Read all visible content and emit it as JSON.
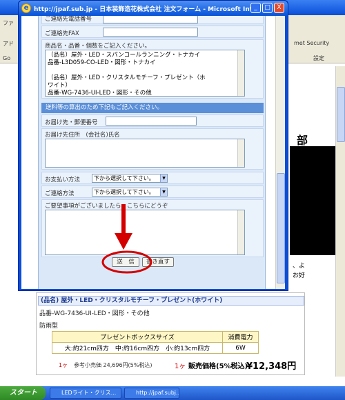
{
  "popup": {
    "title": "http://jpaf.sub.jp - 日本装飾造花株式会社 注文フォーム - Microsoft Interne...",
    "min_label": "_",
    "max_label": "□",
    "close_label": "X"
  },
  "form": {
    "phone_label": "ご連絡先電話番号",
    "fax_label": "ご連絡先FAX",
    "items_label": "商品名・品番・個数をご記入ください。",
    "items_text": "（品名）屋外・LED・スパンコールランニング・トナカイ\n品番-L3D059-CO-LED・図形・トナカイ\n\n（品名）屋外・LED・クリスタルモチーフ・プレゼント（ホ\nワイト）\n品番-WG-7436-UI-LED・図形・その他",
    "shipping_section": "送料等の算出のため下記もご記入ください。",
    "zip_label": "お届け先・郵便番号",
    "address_label": "お届け先住所　(会社名)氏名",
    "payment_label": "お支払い方法",
    "payment_value": "下から選択して下さい。",
    "contact_label": "ご連絡方法",
    "contact_value": "下から選択して下さい。",
    "requests_label": "ご要望事項がございましたら、こちらにどうぞ",
    "submit_label": "送　信",
    "reset_label": "書き直す"
  },
  "product": {
    "name": "(品名) 屋外・LED・クリスタルモチーフ・プレゼント(ホワイト)",
    "model": "品番-WG-7436-UI-LED・図形・その他",
    "weather": "防雨型",
    "table_headers": [
      "プレゼントボックスサイズ",
      "消費電力"
    ],
    "table_sizes": "大:約21cm四方　中:約16cm四方　小:約13cm四方",
    "table_power": "6W",
    "qty_small": "1ヶ",
    "reference_price": "参考小売価 24,696円(5%税込)",
    "qty_large": "1ヶ",
    "price_label": "販売価格(5%税込)",
    "price": "¥12,348円"
  },
  "background": {
    "heading": "部",
    "right_text_1": "met Security",
    "right_text_2": "設定",
    "side_text_1": "ファ",
    "side_text_2": "アド",
    "side_text_3": "Go",
    "right_small_1": "、よ",
    "right_small_2": "お好"
  },
  "taskbar": {
    "start_label": "スタート",
    "task_1": "LEDライト・クリス...",
    "task_2": "http://jpaf.subj..."
  },
  "colors": {
    "accent": "#5b8fd8",
    "annotation": "#d40000"
  }
}
